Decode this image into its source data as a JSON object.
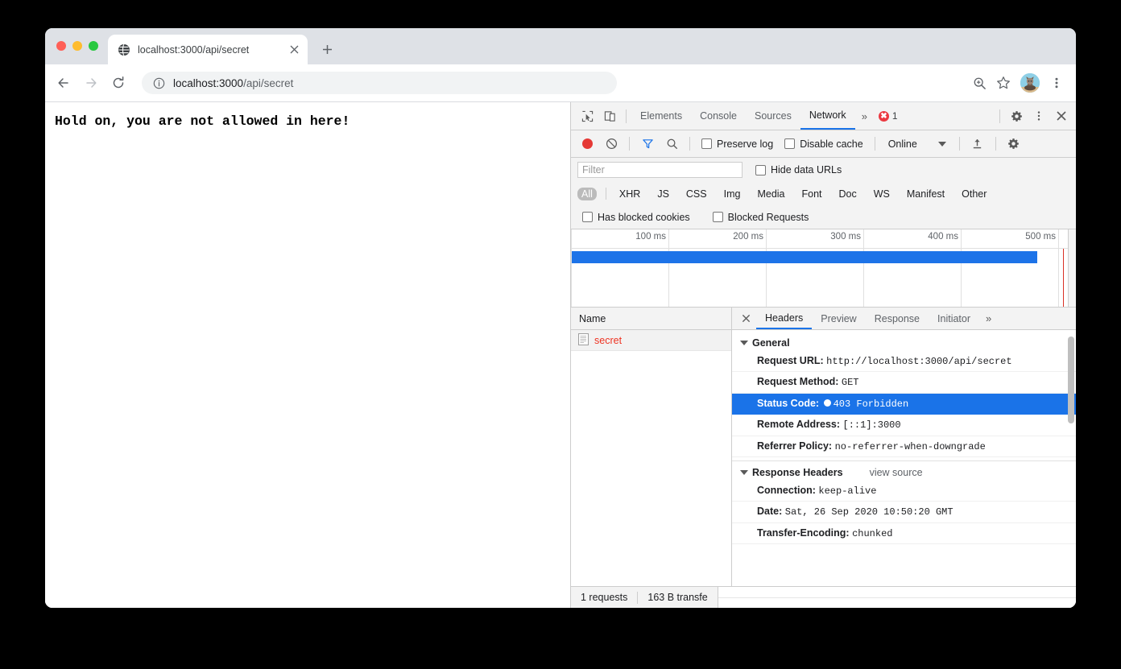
{
  "browser": {
    "tab": {
      "title": "localhost:3000/api/secret",
      "favicon_icon": "globe-icon",
      "close_icon": "close-icon"
    },
    "new_tab_icon": "plus-icon",
    "nav": {
      "back_icon": "arrow-left-icon",
      "forward_icon": "arrow-right-icon",
      "reload_icon": "reload-icon"
    },
    "omnibox": {
      "info_icon": "info-circle-icon",
      "host": "localhost:3000",
      "path": "/api/secret",
      "full_url": "localhost:3000/api/secret"
    },
    "toolbar_right": {
      "zoom_icon": "zoom-in-icon",
      "bookmark_icon": "star-icon",
      "profile_icon": "avatar-cat-icon",
      "menu_icon": "kebab-menu-icon"
    }
  },
  "page": {
    "body_text": "Hold on, you are not allowed in here!"
  },
  "devtools": {
    "top": {
      "inspect_icon": "inspect-cursor-icon",
      "device_icon": "device-toolbar-icon",
      "tabs": [
        {
          "label": "Elements",
          "active": false
        },
        {
          "label": "Console",
          "active": false
        },
        {
          "label": "Sources",
          "active": false
        },
        {
          "label": "Network",
          "active": true
        }
      ],
      "overflow_label": "»",
      "error_count": "1",
      "settings_icon": "gear-icon",
      "menu_icon": "kebab-menu-icon",
      "close_icon": "close-icon"
    },
    "network_toolbar": {
      "record_icon": "record-button",
      "clear_icon": "clear-icon",
      "filter_icon": "funnel-icon",
      "search_icon": "search-icon",
      "preserve_log_label": "Preserve log",
      "disable_cache_label": "Disable cache",
      "throttle_value": "Online",
      "dropdown_icon": "chevron-down-icon",
      "import_icon": "upload-arrow-icon",
      "settings_icon": "gear-icon"
    },
    "filter_row": {
      "filter_placeholder": "Filter",
      "filter_value": "",
      "hide_data_urls_label": "Hide data URLs"
    },
    "type_filters": [
      {
        "label": "All",
        "active": true
      },
      {
        "label": "XHR",
        "active": false
      },
      {
        "label": "JS",
        "active": false
      },
      {
        "label": "CSS",
        "active": false
      },
      {
        "label": "Img",
        "active": false
      },
      {
        "label": "Media",
        "active": false
      },
      {
        "label": "Font",
        "active": false
      },
      {
        "label": "Doc",
        "active": false
      },
      {
        "label": "WS",
        "active": false
      },
      {
        "label": "Manifest",
        "active": false
      },
      {
        "label": "Other",
        "active": false
      }
    ],
    "blocked_row": {
      "has_blocked_cookies_label": "Has blocked cookies",
      "blocked_requests_label": "Blocked Requests"
    },
    "overview": {
      "ticks": [
        "100 ms",
        "200 ms",
        "300 ms",
        "400 ms",
        "500 ms"
      ],
      "bar_color_fill": "#0fae46",
      "bar_color_border": "#1d73e8",
      "marker_red": "#d93025",
      "marker_blue": "#1d73e8"
    },
    "request_list": {
      "column_header": "Name",
      "rows": [
        {
          "name": "secret",
          "icon": "document-icon",
          "failed": true
        }
      ]
    },
    "detail": {
      "close_icon": "close-icon",
      "tabs": [
        {
          "label": "Headers",
          "active": true
        },
        {
          "label": "Preview",
          "active": false
        },
        {
          "label": "Response",
          "active": false
        },
        {
          "label": "Initiator",
          "active": false
        }
      ],
      "overflow_label": "»",
      "general": {
        "title": "General",
        "rows": [
          {
            "key": "Request URL:",
            "value": "http://localhost:3000/api/secret",
            "selected": false
          },
          {
            "key": "Request Method:",
            "value": "GET",
            "selected": false
          },
          {
            "key": "Status Code:",
            "value": "403 Forbidden",
            "selected": true,
            "dot": true
          },
          {
            "key": "Remote Address:",
            "value": "[::1]:3000",
            "selected": false
          },
          {
            "key": "Referrer Policy:",
            "value": "no-referrer-when-downgrade",
            "selected": false
          }
        ]
      },
      "response_headers": {
        "title": "Response Headers",
        "view_source_label": "view source",
        "rows": [
          {
            "key": "Connection:",
            "value": "keep-alive"
          },
          {
            "key": "Date:",
            "value": "Sat, 26 Sep 2020 10:50:20 GMT"
          },
          {
            "key": "Transfer-Encoding:",
            "value": "chunked"
          }
        ]
      }
    },
    "status_bar": {
      "requests": "1 requests",
      "transferred": "163 B transfe"
    }
  }
}
